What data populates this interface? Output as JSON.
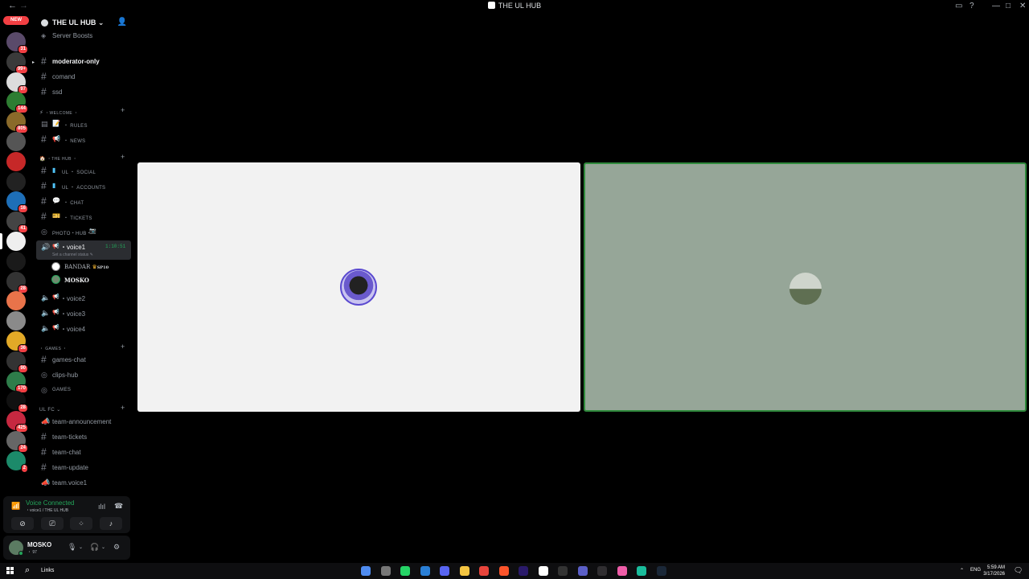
{
  "window": {
    "title": "THE UL HUB",
    "back_icon": "←",
    "forward_icon": "→"
  },
  "server_list": {
    "new_badge": "NEW",
    "servers": [
      {
        "count": "31",
        "color": "#5a4a6a"
      },
      {
        "count": "99+",
        "color": "#3a3a3a"
      },
      {
        "count": "97",
        "color": "#dcdcdc"
      },
      {
        "count": "144",
        "color": "#2e7d32"
      },
      {
        "count": "805",
        "color": "#8a6a2a"
      },
      {
        "count": "",
        "color": "#555"
      },
      {
        "count": "",
        "color": "#c62828"
      },
      {
        "count": "",
        "color": "#222"
      },
      {
        "count": "16",
        "color": "#1e6fb8"
      },
      {
        "count": "41",
        "color": "#444"
      },
      {
        "count": "",
        "color": "#eee"
      },
      {
        "count": "",
        "color": "#1a1a1a"
      },
      {
        "count": "28",
        "color": "#333"
      },
      {
        "count": "",
        "color": "#e8734a"
      },
      {
        "count": "",
        "color": "#8a8a8a"
      },
      {
        "count": "36",
        "color": "#e2a927"
      },
      {
        "count": "90",
        "color": "#333"
      },
      {
        "count": "170",
        "color": "#2e7d4a"
      },
      {
        "count": "28",
        "color": "#111"
      },
      {
        "count": "425",
        "color": "#c62840"
      },
      {
        "count": "24",
        "color": "#666"
      },
      {
        "count": "2",
        "color": "#1c8a6a"
      }
    ]
  },
  "guild": {
    "name": "THE UL HUB",
    "channels": {
      "server_boosts": "Server Boosts",
      "moderator_only": "moderator-only",
      "comand": "comand",
      "ssd": "ssd",
      "cat_welcome": "・WELCOME ・",
      "rules": "・ RULES",
      "news": "・ NEWS",
      "cat_hub": "・THE HUB ・",
      "ul_social": "UL ・ SOCIAL",
      "ul_accounts": "UL ・ ACCOUNTS",
      "chat": "・ CHAT",
      "tickets": "・ TICKETS",
      "photo_hub": "PHOTO・HUB・",
      "voice1": "・voice1",
      "voice1_timer": "1:10:51",
      "voice1_status": "Set a channel status",
      "voice2": "・voice2",
      "voice3": "・voice3",
      "voice4": "・voice4",
      "cat_games": "・ GAMES ・",
      "games_chat": "games-chat",
      "clips_hub": "clips-hub",
      "games": "GAMES",
      "cat_ulfc": "UL FC",
      "team_announcement": "team-announcement",
      "team_tickets": "team-tickets",
      "team_chat": "team-chat",
      "team_update": "team-update",
      "team_voice1": "team.voice1"
    },
    "voice_users": [
      {
        "name": "BANDAR",
        "tag": "SP10"
      },
      {
        "name": "MOSKO",
        "tag": ""
      }
    ]
  },
  "voice_panel": {
    "status": "Voice Connected",
    "channel": "・voice1 / THE UL HUB"
  },
  "user_panel": {
    "username": "MOSKO",
    "subtext": "・ 97"
  },
  "taskbar": {
    "search_label": "Links",
    "lang": "ENG",
    "time": "5:59 AM",
    "date": "3/17/2026"
  }
}
